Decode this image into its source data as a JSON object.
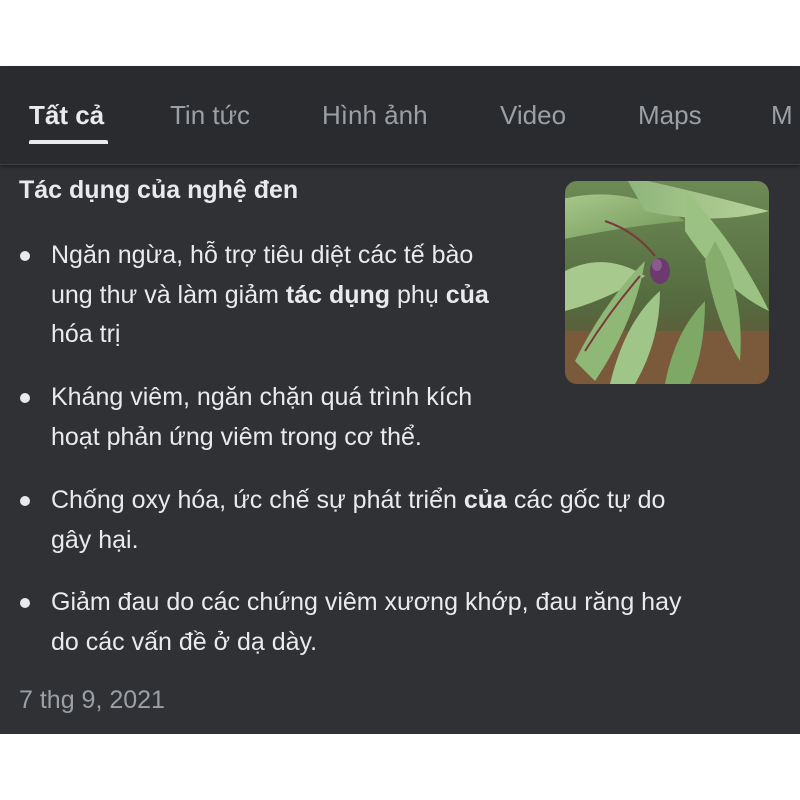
{
  "tabs": [
    {
      "label": "Tất cả",
      "active": true
    },
    {
      "label": "Tin tức",
      "active": false
    },
    {
      "label": "Hình ảnh",
      "active": false
    },
    {
      "label": "Video",
      "active": false
    },
    {
      "label": "Maps",
      "active": false
    },
    {
      "label": "M",
      "active": false
    }
  ],
  "result": {
    "heading": "Tác dụng của nghệ đen",
    "image_alt": "turmeric-plant-thumbnail",
    "bullets": [
      {
        "lines": [
          "Ngăn ngừa, hỗ trợ tiêu diệt các tế bào",
          [
            "ung thư và làm giảm ",
            "tác dụng",
            " phụ ",
            "của"
          ],
          "hóa trị"
        ]
      },
      {
        "lines": [
          "Kháng viêm, ngăn chặn quá trình kích",
          "hoạt phản ứng viêm trong cơ thể."
        ]
      },
      {
        "lines": [
          [
            "Chống oxy hóa, ức chế sự phát triển ",
            "của",
            " các gốc tự do"
          ],
          "gây hại."
        ]
      },
      {
        "lines": [
          "Giảm đau do các chứng viêm xương khớp, đau răng hay",
          "do các vấn đề ở dạ dày."
        ]
      }
    ],
    "date": "7 thg 9, 2021"
  },
  "colors": {
    "panel_bg": "#303134",
    "tabbar_bg": "#2a2b2e",
    "text": "#e8eaed",
    "muted": "#9aa0a6"
  }
}
